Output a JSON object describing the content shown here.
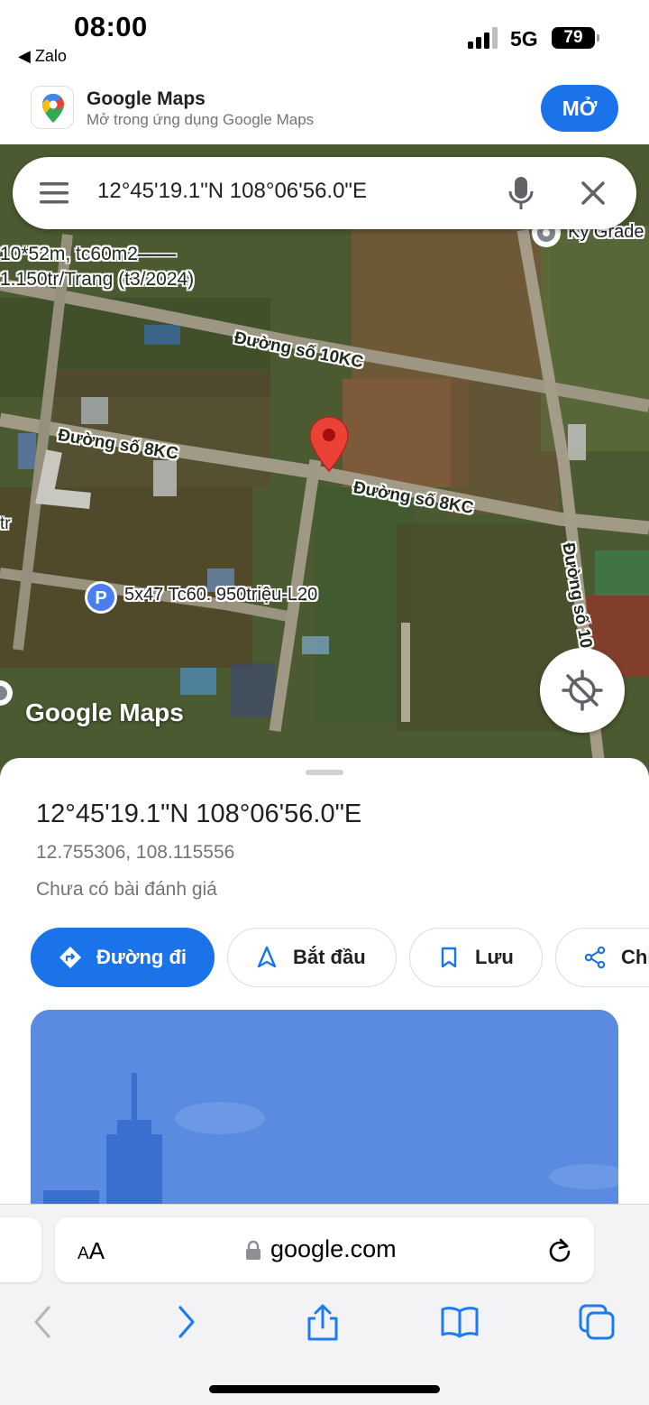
{
  "status_bar": {
    "time": "08:00",
    "back_app": "◀ Zalo",
    "network": "5G",
    "battery": "79"
  },
  "app_banner": {
    "name": "Google Maps",
    "subtitle": "Mở trong ứng dụng Google Maps",
    "open_label": "MỞ"
  },
  "search": {
    "query": "12°45'19.1\"N 108°06'56.0\"E"
  },
  "map": {
    "labels": {
      "listing_top_1": "10*52m, tc60m2——",
      "listing_top_2": "1.150tr/Trang (t3/2024)",
      "road_10kc": "Đường số 10KC",
      "road_8kc_left": "Đường số 8KC",
      "road_8kc_right": "Đường số 8KC",
      "road_vertical": "Đường số 10",
      "place_top_right": "Ky Grade",
      "parking_label": "5x47 Tc60. 950triệu-L20",
      "left_fragment": "tr",
      "watermark": "Google Maps"
    }
  },
  "place": {
    "title": "12°45'19.1\"N 108°06'56.0\"E",
    "coords": "12.755306, 108.115556",
    "reviews": "Chưa có bài đánh giá"
  },
  "actions": {
    "directions": "Đường đi",
    "start": "Bắt đầu",
    "save": "Lưu",
    "share": "Chia sẻ"
  },
  "browser": {
    "aa_big": "A",
    "aa_small": "A",
    "url": "google.com"
  },
  "colors": {
    "accent": "#1a73e8",
    "pin": "#ea4335"
  }
}
